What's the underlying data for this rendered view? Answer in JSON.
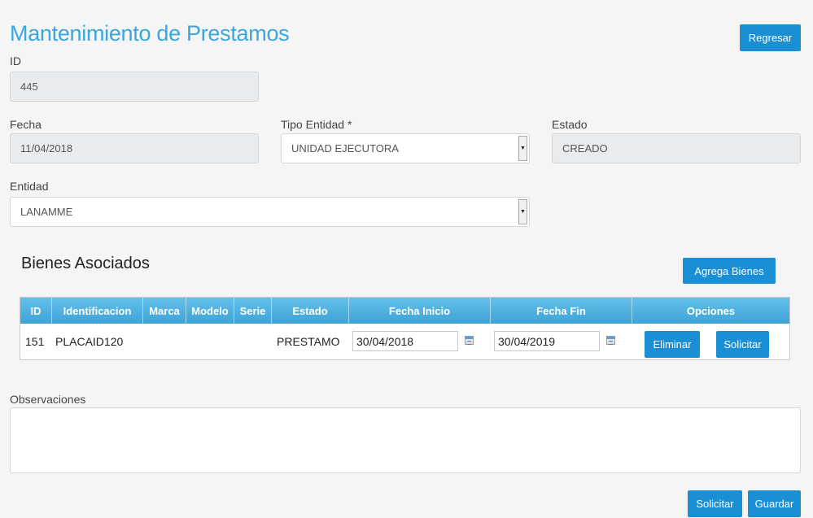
{
  "page": {
    "title": "Mantenimiento de Prestamos",
    "back_button": "Regresar"
  },
  "form": {
    "id": {
      "label": "ID",
      "value": "445"
    },
    "fecha": {
      "label": "Fecha",
      "value": "11/04/2018"
    },
    "tipo_entidad": {
      "label": "Tipo Entidad *",
      "value": "UNIDAD EJECUTORA"
    },
    "estado": {
      "label": "Estado",
      "value": "CREADO"
    },
    "entidad": {
      "label": "Entidad",
      "value": "LANAMME"
    }
  },
  "bienes": {
    "title": "Bienes Asociados",
    "add_button": "Agrega Bienes",
    "columns": [
      "ID",
      "Identificacion",
      "Marca",
      "Modelo",
      "Serie",
      "Estado",
      "Fecha Inicio",
      "Fecha Fin",
      "Opciones"
    ],
    "rows": [
      {
        "id": "151",
        "identificacion": "PLACAID120",
        "marca": "",
        "modelo": "",
        "serie": "",
        "estado": "PRESTAMO",
        "fecha_inicio": "30/04/2018",
        "fecha_fin": "30/04/2019",
        "eliminar": "Eliminar",
        "solicitar": "Solicitar"
      }
    ]
  },
  "observaciones": {
    "label": "Observaciones",
    "value": ""
  },
  "footer": {
    "solicitar": "Solicitar",
    "guardar": "Guardar"
  },
  "colors": {
    "accent": "#1b8fd6",
    "title": "#3aa6dd",
    "header_gradient_top": "#64c0ea",
    "header_gradient_bottom": "#3ea3d6"
  }
}
